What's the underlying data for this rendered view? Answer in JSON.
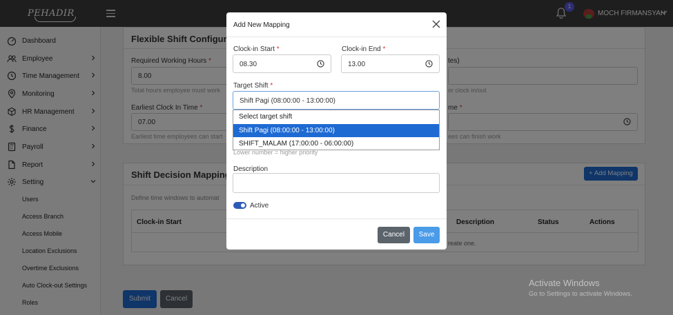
{
  "app": {
    "logo_text": "PEHADIR",
    "notification_count": "1",
    "user_name": "MOCH FIRMANSYAH"
  },
  "sidebar": {
    "items": [
      {
        "label": "Dashboard",
        "icon": "dashboard-icon"
      },
      {
        "label": "Employee",
        "icon": "users-icon"
      },
      {
        "label": "Time Management",
        "icon": "clock-icon"
      },
      {
        "label": "Monitoring",
        "icon": "location-pin-icon"
      },
      {
        "label": "HR Management",
        "icon": "cube-icon"
      },
      {
        "label": "Finance",
        "icon": "dollar-icon"
      },
      {
        "label": "Payroll",
        "icon": "calculator-icon"
      },
      {
        "label": "Report",
        "icon": "document-icon"
      },
      {
        "label": "Setting",
        "icon": "gear-icon"
      }
    ],
    "sub_items": [
      "Users",
      "Access Branch",
      "Access Mobile",
      "Location Exclusions",
      "Overtime Exclusions",
      "Auto Clock-out Settings",
      "Roles"
    ]
  },
  "page": {
    "flex_card": {
      "title": "Flexible Shift Configurati",
      "required_hours_label": "Required Working Hours",
      "required_hours_value": "8.00",
      "required_hours_help": "Total hours employee must work",
      "right_top_label_partial": "tes)",
      "right_top_help_partial": "or clock in/out",
      "earliest_label": "Earliest Clock In Time",
      "earliest_value": "07.00",
      "earliest_help": "Earliest time employees can start",
      "right_mid_label_partial": "me",
      "right_mid_help_partial": "ees can finish work"
    },
    "decision_card": {
      "title": "Shift Decision Mappings",
      "add_button": "+ Add Mapping",
      "description": "Define time windows to automat",
      "columns": [
        "Clock-in Start",
        "Description",
        "Status",
        "Actions"
      ],
      "empty_partial": "reate one."
    },
    "submit_label": "Submit",
    "cancel_label": "Cancel"
  },
  "modal": {
    "title": "Add New Mapping",
    "clockin_start_label": "Clock-in Start",
    "clockin_start_value": "08.30",
    "clockin_end_label": "Clock-in End",
    "clockin_end_value": "13.00",
    "target_shift_label": "Target Shift",
    "target_shift_value": "Shift Pagi (08:00:00 - 13:00:00)",
    "target_shift_options": [
      "Select target shift",
      "Shift Pagi (08:00:00 - 13:00:00)",
      "SHIFT_MALAM (17:00:00 - 06:00:00)"
    ],
    "selected_option_index": 1,
    "priority_help_partial": "Lower number = higher priority",
    "description_label": "Description",
    "description_value": "",
    "active_label": "Active",
    "active_on": true,
    "cancel_label": "Cancel",
    "save_label": "Save"
  },
  "watermark": {
    "line1": "Activate Windows",
    "line2": "Go to Settings to activate Windows."
  },
  "colors": {
    "topbar": "#3c3c3c",
    "primary": "#1e6ad3",
    "save": "#4a9be8",
    "cancel": "#5b636b"
  }
}
